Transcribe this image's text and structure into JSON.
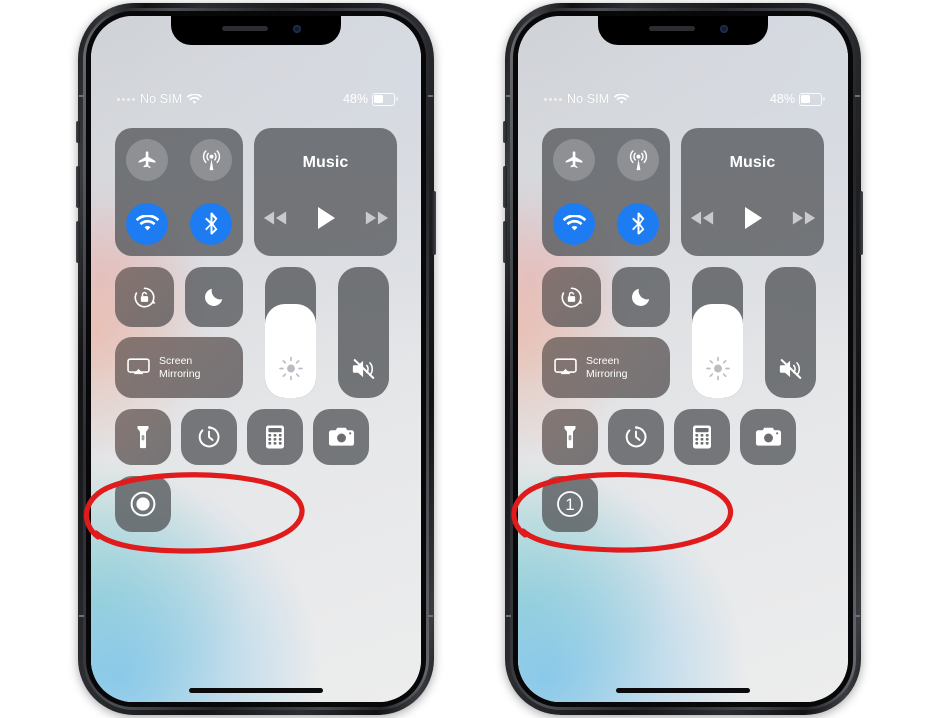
{
  "scene": {
    "description": "Two iPhone X screenshots side by side showing iOS Control Center before and after tapping the screen recording button",
    "background_color": "#ffffff",
    "annotation_color": "#e01b1b"
  },
  "status_bar": {
    "carrier": "No SIM",
    "wifi_icon": "wifi-icon",
    "signal_icon": "signal-dots-icon",
    "battery_percent": "48%",
    "battery_fill_pct": 48,
    "battery_icon": "battery-icon"
  },
  "control_center": {
    "connectivity": {
      "airplane": {
        "name": "airplane-mode-toggle",
        "icon": "airplane-icon",
        "state": "off"
      },
      "cellular": {
        "name": "cellular-data-toggle",
        "icon": "cellular-antenna-icon",
        "state": "off"
      },
      "wifi": {
        "name": "wifi-toggle",
        "icon": "wifi-icon",
        "state": "on"
      },
      "bluetooth": {
        "name": "bluetooth-toggle",
        "icon": "bluetooth-icon",
        "state": "on"
      },
      "on_color": "#1d7cf2",
      "off_color": "#96989c"
    },
    "music": {
      "title": "Music",
      "previous_label": "previous-track",
      "play_label": "play",
      "next_label": "next-track"
    },
    "rotation_lock": {
      "label": "rotation-lock",
      "icon": "rotation-lock-icon",
      "state": "off"
    },
    "do_not_disturb": {
      "label": "do-not-disturb",
      "icon": "moon-icon",
      "state": "off"
    },
    "screen_mirroring": {
      "line1": "Screen",
      "line2": "Mirroring",
      "icon": "airplay-icon"
    },
    "brightness": {
      "label": "brightness-slider",
      "icon": "sun-icon",
      "value_pct": 72
    },
    "volume": {
      "label": "volume-slider",
      "icon": "mute-speaker-icon",
      "value_pct": 0,
      "muted": true
    },
    "shortcuts": [
      {
        "name": "flashlight-button",
        "icon": "flashlight-icon"
      },
      {
        "name": "timer-button",
        "icon": "timer-icon"
      },
      {
        "name": "calculator-button",
        "icon": "calculator-icon"
      },
      {
        "name": "camera-button",
        "icon": "camera-icon"
      }
    ]
  },
  "phones": [
    {
      "id": "phone-left",
      "caption_state": "idle",
      "record_button": {
        "name": "screen-record-button",
        "icon": "record-dot-icon",
        "countdown": null
      },
      "annotation": {
        "shape": "ellipse",
        "target": "screen-record-button"
      }
    },
    {
      "id": "phone-right",
      "caption_state": "counting-down",
      "record_button": {
        "name": "screen-record-button",
        "icon": "countdown-number",
        "countdown": "1"
      },
      "annotation": {
        "shape": "ellipse",
        "target": "screen-record-button"
      }
    }
  ]
}
